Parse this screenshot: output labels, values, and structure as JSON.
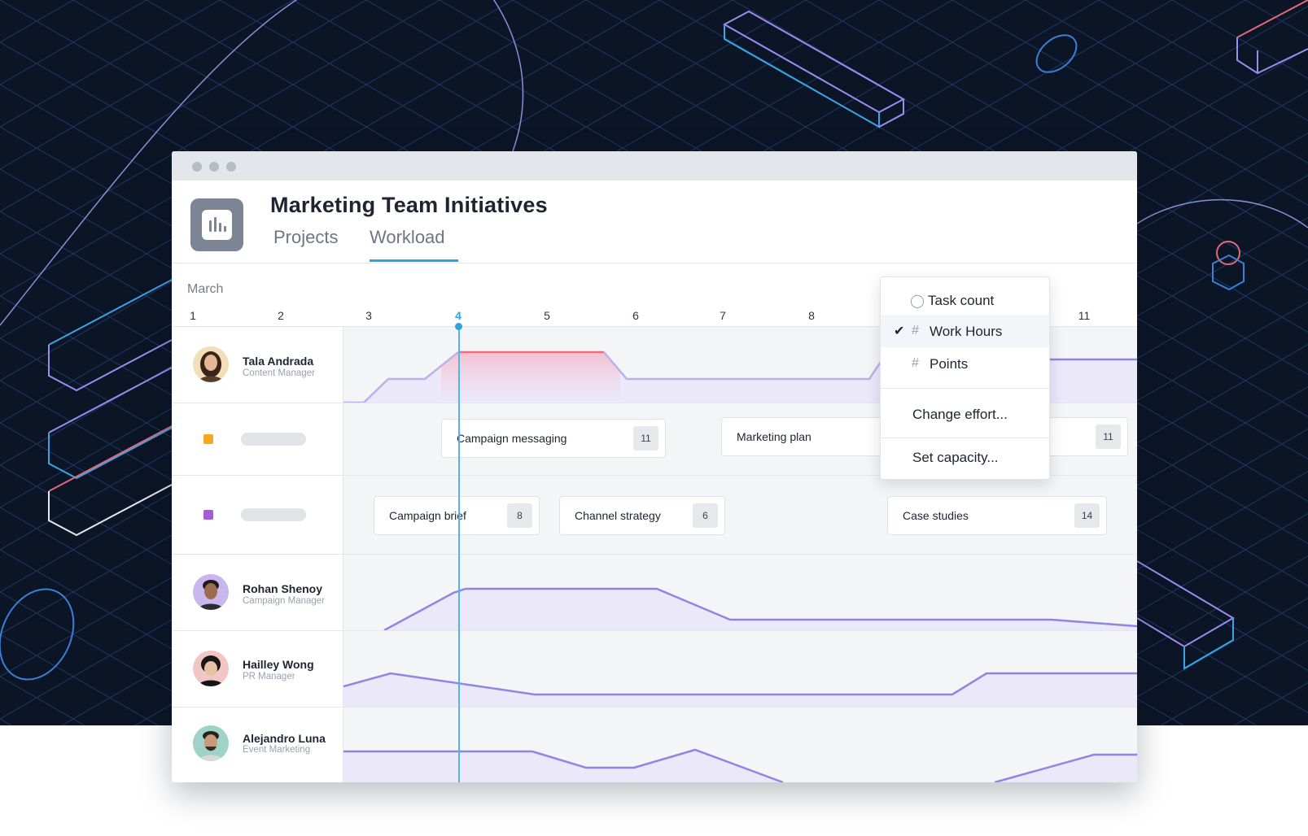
{
  "app": {
    "title": "Marketing Team Initiatives",
    "icon": "bar-chart-icon",
    "tabs": [
      {
        "label": "Projects",
        "active": false
      },
      {
        "label": "Workload",
        "active": true
      }
    ],
    "accent_color": "#2ea3d9"
  },
  "timeline": {
    "month": "March",
    "days": [
      "1",
      "2",
      "3",
      "4",
      "5",
      "6",
      "7",
      "8",
      "11"
    ],
    "today": "4"
  },
  "people": [
    {
      "name": "Tala Andrada",
      "role": "Content Manager"
    },
    {
      "name": "Rohan Shenoy",
      "role": "Campaign Manager"
    },
    {
      "name": "Hailley Wong",
      "role": "PR Manager"
    },
    {
      "name": "Alejandro Luna",
      "role": "Event Marketing"
    }
  ],
  "project_rows": [
    {
      "color": "#f5a623",
      "tasks": [
        {
          "name": "Campaign messaging",
          "count": "11"
        },
        {
          "name": "Marketing plan",
          "count": "11"
        }
      ]
    },
    {
      "color": "#a35ddb",
      "tasks": [
        {
          "name": "Campaign brief",
          "count": "8"
        },
        {
          "name": "Channel strategy",
          "count": "6"
        },
        {
          "name": "Case studies",
          "count": "14"
        }
      ]
    }
  ],
  "menu": {
    "items": [
      {
        "label": "Task count",
        "icon": "check-circle-icon",
        "checked": false
      },
      {
        "label": "Work Hours",
        "icon": "hash-icon",
        "checked": true
      },
      {
        "label": "Points",
        "icon": "hash-icon",
        "checked": false
      }
    ],
    "actions": [
      "Change effort...",
      "Set capacity..."
    ]
  }
}
